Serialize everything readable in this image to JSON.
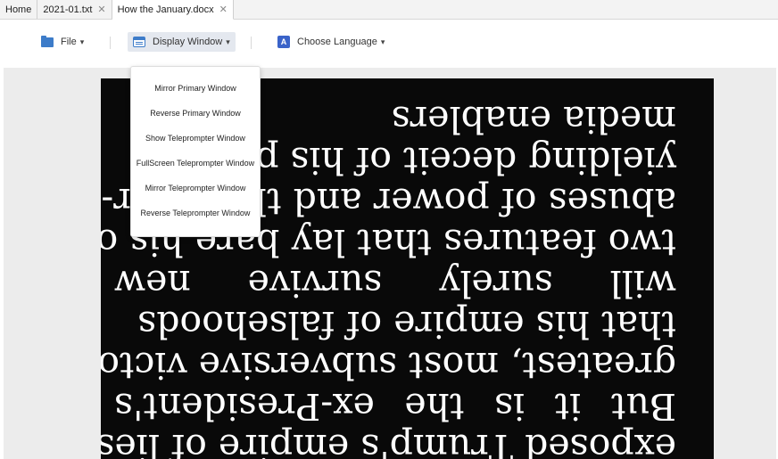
{
  "tabs": [
    {
      "label": "Home",
      "closable": false
    },
    {
      "label": "2021-01.txt",
      "closable": true
    },
    {
      "label": "How the January.docx",
      "closable": true,
      "active": true
    }
  ],
  "toolbar": {
    "file": {
      "label": "File",
      "icon": "folder-icon"
    },
    "display_window": {
      "label": "Display Window",
      "icon": "window-icon"
    },
    "choose_language": {
      "label": "Choose Language",
      "icon": "language-icon",
      "icon_letter": "A"
    }
  },
  "display_menu": {
    "items": [
      "Mirror Primary Window",
      "Reverse Primary Window",
      "Show Teleprompter Window",
      "FullScreen Teleprompter Window",
      "Mirror Teleprompter Window",
      "Reverse Teleprompter Window"
    ]
  },
  "prompter": {
    "background": "#090909",
    "text_color": "#ffffff",
    "lines": [
      [
        "exposed Trump's empire of lies"
      ],
      [
        "But",
        "it",
        "is",
        "the",
        "ex-President's"
      ],
      [
        "greatest, most subversive victory"
      ],
      [
        "that his empire of falsehoods"
      ],
      [
        "will",
        "surely",
        "survive",
        "new"
      ],
      [
        "two features that lay bare his own"
      ],
      [
        "abuses of power and the voter-"
      ],
      [
        "yielding deceit of his political"
      ],
      [
        "media enablers"
      ]
    ]
  },
  "colors": {
    "accent": "#3d7cc9",
    "menu_highlight": "#e4e8ef"
  }
}
